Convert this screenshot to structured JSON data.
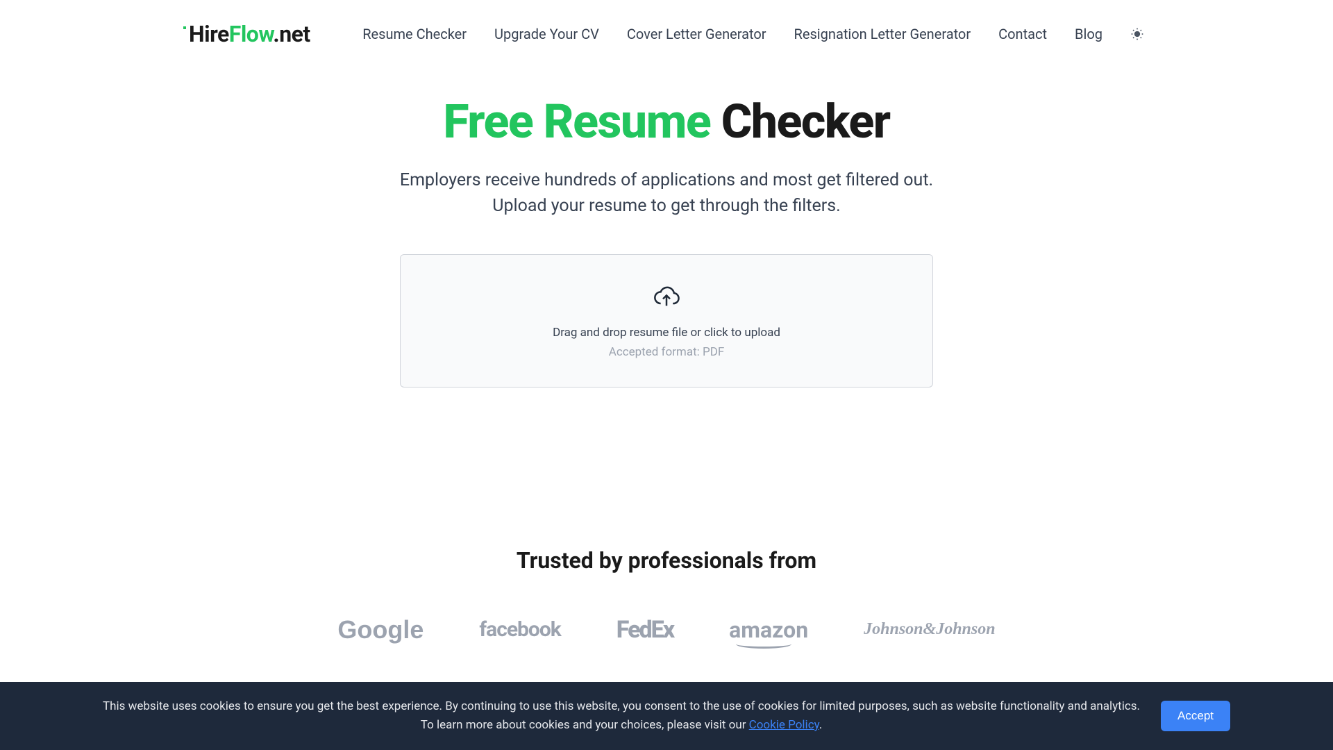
{
  "logo": {
    "part1": "Hire",
    "part2": "Flow",
    "part3": ".net"
  },
  "nav": {
    "items": [
      "Resume Checker",
      "Upgrade Your CV",
      "Cover Letter Generator",
      "Resignation Letter Generator",
      "Contact",
      "Blog"
    ]
  },
  "hero": {
    "title_green": "Free Resume",
    "title_black": " Checker",
    "subtitle_line1": "Employers receive hundreds of applications and most get filtered out.",
    "subtitle_line2": "Upload your resume to get through the filters."
  },
  "upload": {
    "text": "Drag and drop resume file or click to upload",
    "subtext": "Accepted format: PDF"
  },
  "trusted": {
    "title": "Trusted by professionals from",
    "companies": [
      "Google",
      "facebook",
      "FedEx",
      "amazon",
      "Johnson&Johnson"
    ]
  },
  "cookie": {
    "text_part1": "This website uses cookies to ensure you get the best experience. By continuing to use this website, you consent to the use of cookies for limited purposes, such as website functionality and analytics.",
    "text_part2": "To learn more about cookies and your choices, please visit our ",
    "link_text": "Cookie Policy",
    "text_part3": ".",
    "accept_label": "Accept"
  }
}
